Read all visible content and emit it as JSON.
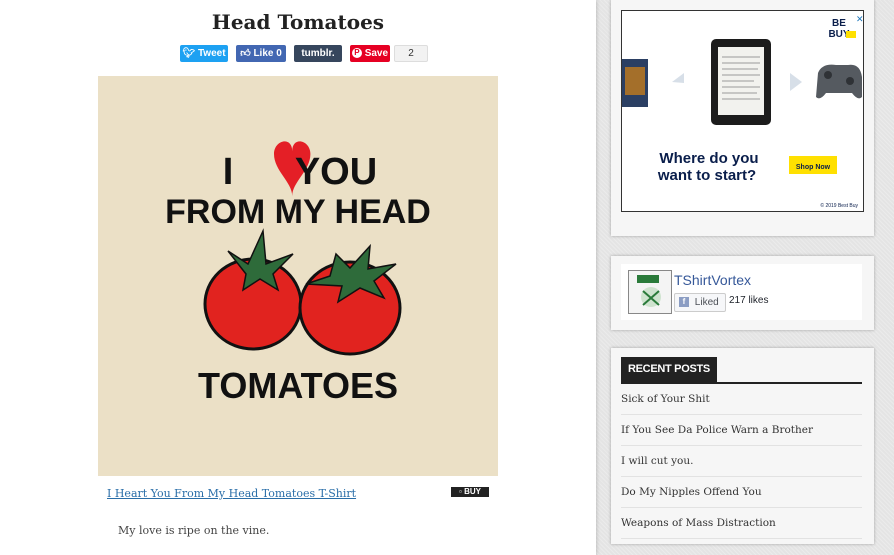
{
  "post": {
    "title": "Head Tomatoes",
    "product_link": "I Heart You From My Head Tomatoes T-Shirt",
    "buy_label": "BUY",
    "description": "My love is ripe on the vine."
  },
  "share": {
    "tweet": "Tweet",
    "like": "Like 0",
    "tumblr": "tumblr.",
    "save": "Save",
    "count": "2"
  },
  "art": {
    "line1_left": "I",
    "line1_right": "YOU",
    "line2": "FROM MY HEAD",
    "line3": "TOMATOES"
  },
  "ad": {
    "brand": "BEST BUY",
    "headline_1": "Where do you",
    "headline_2": "want to start?",
    "cta": "Shop Now",
    "copyright": "© 2019 Best Buy"
  },
  "facebook": {
    "page_name": "TShirtVortex",
    "liked_label": "Liked",
    "likes": "217 likes"
  },
  "recent_posts": {
    "heading": "RECENT POSTS",
    "items": [
      "Sick of Your Shit",
      "If You See Da Police Warn a Brother",
      "I will cut you.",
      "Do My Nipples Offend You",
      "Weapons of Mass Distraction"
    ]
  },
  "colors": {
    "heart": "#e41f26",
    "tomato": "#e1231f",
    "stem": "#2e6b3a",
    "link": "#2a6ea8"
  }
}
